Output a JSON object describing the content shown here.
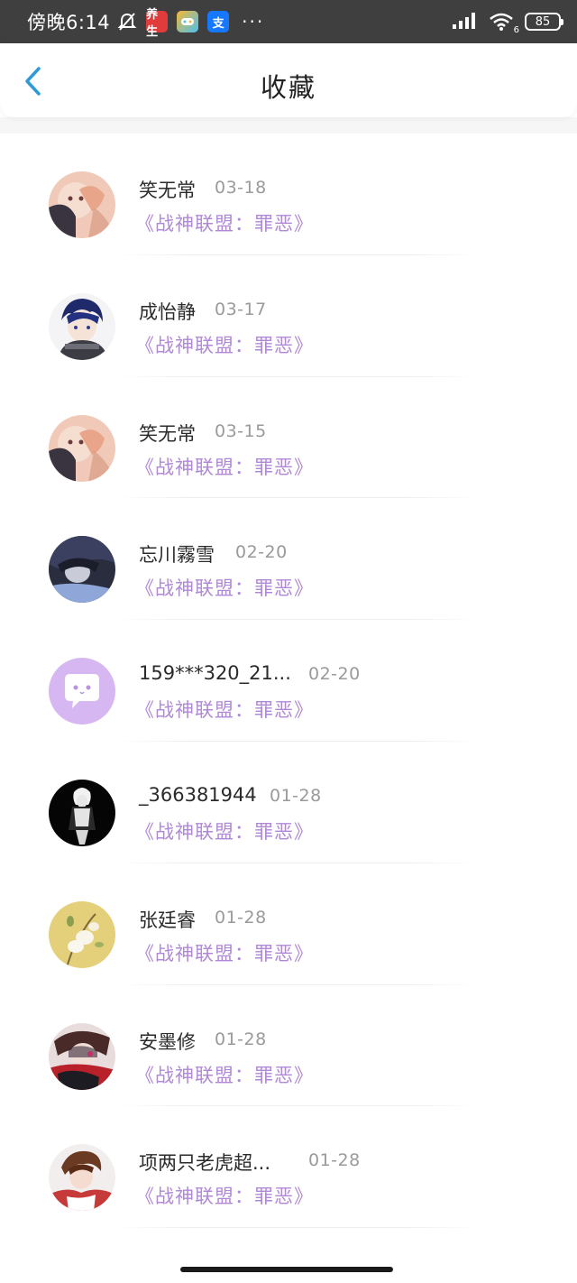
{
  "status_bar": {
    "time": "傍晚6:14",
    "app_icons": [
      {
        "icon": "notification-muted-icon"
      },
      {
        "icon": "app-red-icon",
        "label": "养生"
      },
      {
        "icon": "game-center-icon"
      },
      {
        "icon": "alipay-icon",
        "label": "支"
      }
    ],
    "more": "···",
    "network_type": "6",
    "battery": "85"
  },
  "header": {
    "title": "收藏",
    "back_icon": "chevron-left-icon",
    "accent_color": "#2f9bd6"
  },
  "colors": {
    "work_title": "#b088d8",
    "date": "#9a9a9a",
    "name": "#2b2b2b"
  },
  "favorites": [
    {
      "name": "笑无常",
      "date": "03-18",
      "work": "《战神联盟：罪恶》",
      "avatar": "avatar-anime-girl-pink"
    },
    {
      "name": "成怡静",
      "date": "03-17",
      "work": "《战神联盟：罪恶》",
      "avatar": "avatar-anime-boy-scarf"
    },
    {
      "name": "笑无常",
      "date": "03-15",
      "work": "《战神联盟：罪恶》",
      "avatar": "avatar-anime-girl-pink"
    },
    {
      "name": "忘川霧雪",
      "date": "02-20",
      "work": "《战神联盟：罪恶》",
      "avatar": "avatar-anime-dark"
    },
    {
      "name": "159***320_21...",
      "date": "02-20",
      "work": "《战神联盟：罪恶》",
      "avatar": "avatar-default-chat"
    },
    {
      "name": "_366381944",
      "date": "01-28",
      "work": "《战神联盟：罪恶》",
      "avatar": "avatar-anime-white-hair"
    },
    {
      "name": "张廷睿",
      "date": "01-28",
      "work": "《战神联盟：罪恶》",
      "avatar": "avatar-flower"
    },
    {
      "name": "安墨修",
      "date": "01-28",
      "work": "《战神联盟：罪恶》",
      "avatar": "avatar-anime-red"
    },
    {
      "name": "项两只老虎超...",
      "date": "01-28",
      "work": "《战神联盟：罪恶》",
      "avatar": "avatar-anime-brown-hair"
    }
  ]
}
